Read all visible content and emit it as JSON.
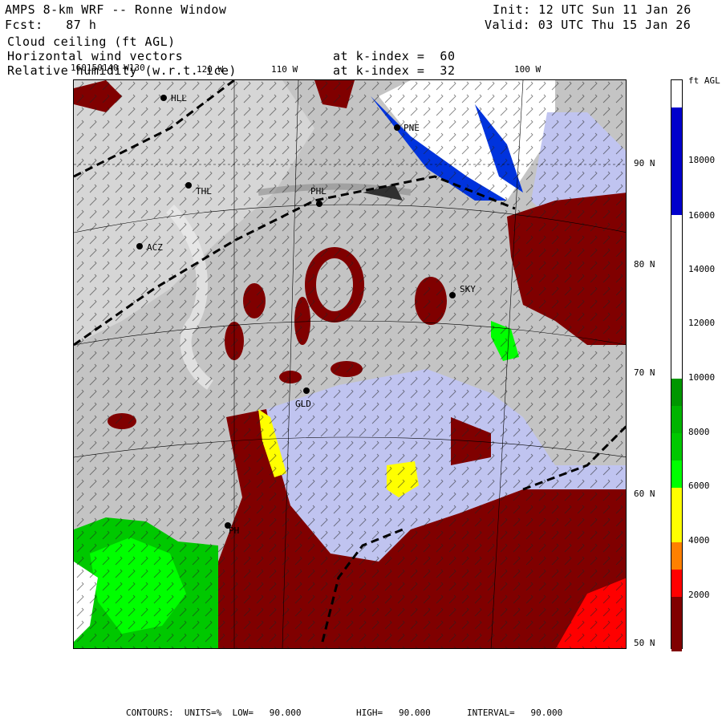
{
  "header": {
    "line1_left": "AMPS 8-km WRF -- Ronne Window",
    "line2_left": "Fcst:   87 h",
    "line1_right": "Init: 12 UTC Sun 11 Jan 26",
    "line2_right": "Valid: 03 UTC Thu 15 Jan 26",
    "field1": "Cloud ceiling (ft AGL)",
    "field2": "Horizontal wind vectors",
    "field2_level": "at k-index =  60",
    "field3": "Relative humidity (w.r.t. ice)",
    "field3_level": "at k-index =  32"
  },
  "longitude_labels": [
    "160150140 W130",
    "120 W",
    "110 W",
    "100 W"
  ],
  "latitude_labels": [
    "90 N",
    "80 N",
    "70 N",
    "60 N",
    "50 N"
  ],
  "stations": [
    "HLL",
    "PNE",
    "THL",
    "PHL",
    "ACZ",
    "SKY",
    "GLD",
    "PH"
  ],
  "colorbar": {
    "title": "ft AGL",
    "ticks": [
      "18000",
      "16000",
      "14000",
      "12000",
      "10000",
      "8000",
      "6000",
      "4000",
      "2000"
    ],
    "colors": [
      "#ffffff",
      "#0000cc",
      "#ffffff",
      "#ffffff",
      "#ffffff",
      "#ffffff",
      "#009600",
      "#00c800",
      "#00ff00",
      "#ffff00",
      "#ff8000",
      "#ff0000",
      "#800000"
    ]
  },
  "footer": {
    "contours": "CONTOURS:  UNITS=%  LOW=   90.000",
    "high": "HIGH=   90.000",
    "interval": "INTERVAL=   90.000"
  }
}
